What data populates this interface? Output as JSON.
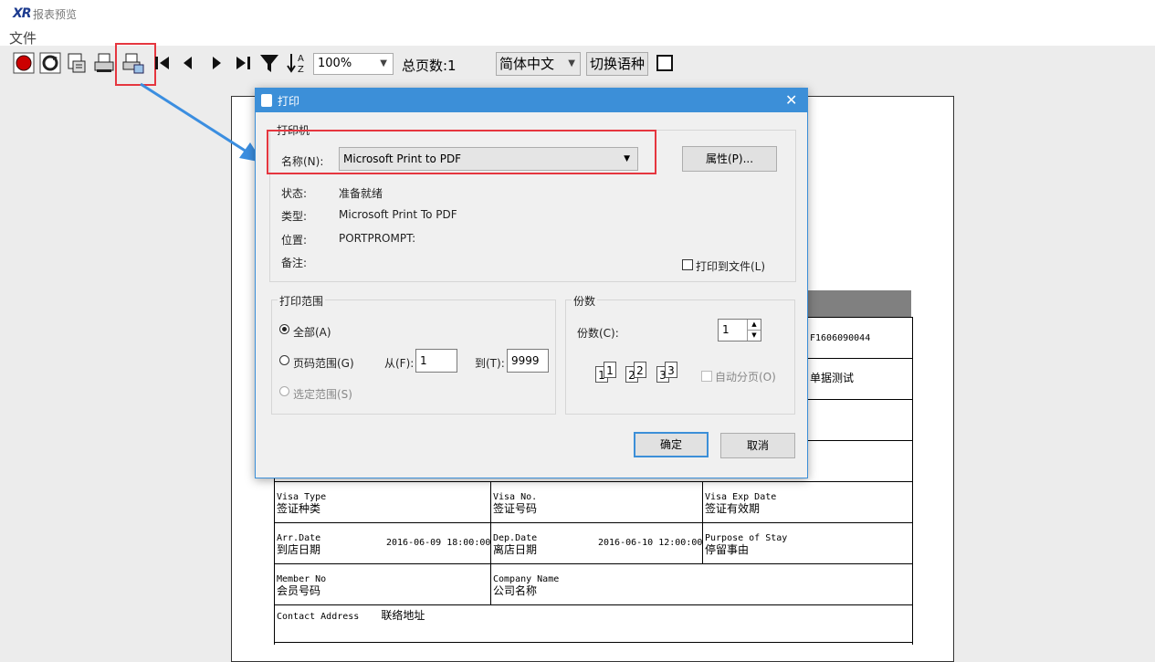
{
  "window": {
    "logo": "XR",
    "title": "报表预览",
    "menu_file": "文件"
  },
  "toolbar": {
    "icons": [
      "record-icon",
      "refresh-icon",
      "export-icon",
      "print-icon",
      "print-preview-icon",
      "first-page-icon",
      "prev-page-icon",
      "next-page-icon",
      "last-page-icon",
      "filter-icon",
      "sort-az-icon"
    ],
    "zoom": "100%",
    "total_pages": "总页数:1",
    "language": "简体中文",
    "switch_language": "切换语种"
  },
  "report": {
    "row_top_values": [
      "F1606090044",
      "单据测试"
    ],
    "visa_type": {
      "en": "Visa Type",
      "cn": "签证种类"
    },
    "visa_no": {
      "en": "Visa No.",
      "cn": "签证号码"
    },
    "visa_exp": {
      "en": "Visa Exp Date",
      "cn": "签证有效期"
    },
    "arr_date": {
      "en": "Arr.Date",
      "cn": "到店日期",
      "value": "2016-06-09 18:00:00"
    },
    "dep_date": {
      "en": "Dep.Date",
      "cn": "离店日期",
      "value": "2016-06-10 12:00:00"
    },
    "purpose": {
      "en": "Purpose of Stay",
      "cn": "停留事由"
    },
    "member_no": {
      "en": "Member No",
      "cn": "会员号码"
    },
    "company": {
      "en": "Company Name",
      "cn": "公司名称"
    },
    "contact": {
      "en": "Contact Address",
      "cn": "联络地址"
    }
  },
  "dialog": {
    "title": "打印",
    "printer_group": "打印机",
    "name_label": "名称(N):",
    "printer_name": "Microsoft Print to PDF",
    "properties_button": "属性(P)...",
    "status_label": "状态:",
    "status_value": "准备就绪",
    "type_label": "类型:",
    "type_value": "Microsoft Print To PDF",
    "location_label": "位置:",
    "location_value": "PORTPROMPT:",
    "comment_label": "备注:",
    "print_to_file": "打印到文件(L)",
    "range_group": "打印范围",
    "range_all": "全部(A)",
    "range_pages": "页码范围(G)",
    "range_selection": "选定范围(S)",
    "from_label": "从(F):",
    "from_value": "1",
    "to_label": "到(T):",
    "to_value": "9999",
    "copies_group": "份数",
    "copies_label": "份数(C):",
    "copies_value": "1",
    "collate": "自动分页(O)",
    "ok_button": "确定",
    "cancel_button": "取消"
  },
  "colors": {
    "accent": "#3c8fd8",
    "highlight": "#e5363f"
  }
}
